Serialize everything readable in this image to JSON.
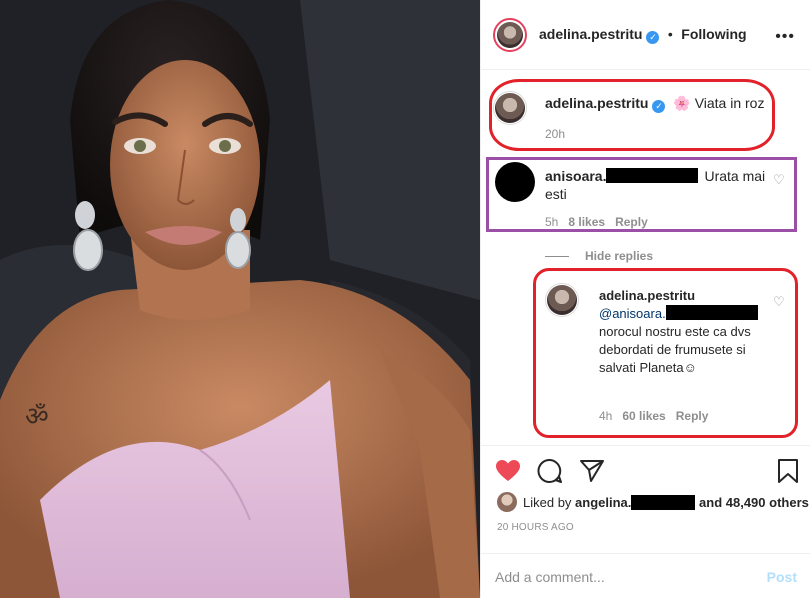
{
  "header": {
    "username": "adelina.pestritu",
    "separator": "•",
    "follow_state": "Following",
    "more": "•••"
  },
  "caption": {
    "username": "adelina.pestritu",
    "emoji": "🌸",
    "text": "Viata in roz",
    "time": "20h"
  },
  "comment1": {
    "username": "anisoara.",
    "text": "Urata mai esti",
    "time": "5h",
    "likes": "8 likes",
    "reply": "Reply"
  },
  "hide_replies": "Hide replies",
  "comment2": {
    "username": "adelina.pestritu",
    "mention": "@anisoara.",
    "text": "norocul nostru este ca dvs debordati de frumusete si salvati Planeta",
    "emoji": "☺",
    "time": "4h",
    "likes": "60 likes",
    "reply": "Reply"
  },
  "actions": {
    "liked_by_prefix": "Liked by",
    "liked_by_user": "angelina.",
    "liked_by_suffix": "and 48,490 others",
    "time_ago": "20 HOURS AGO"
  },
  "comment_box": {
    "placeholder": "Add a comment...",
    "post_label": "Post"
  },
  "colors": {
    "like_red": "#ed4956",
    "verified_blue": "#3897f0",
    "annotation_red": "#e2222a",
    "annotation_purple": "#9b4fa6",
    "post_disabled": "#b2dffc"
  },
  "icons": [
    "heart-icon",
    "comment-icon",
    "share-icon",
    "bookmark-icon",
    "verified-icon",
    "small-heart-icon"
  ]
}
